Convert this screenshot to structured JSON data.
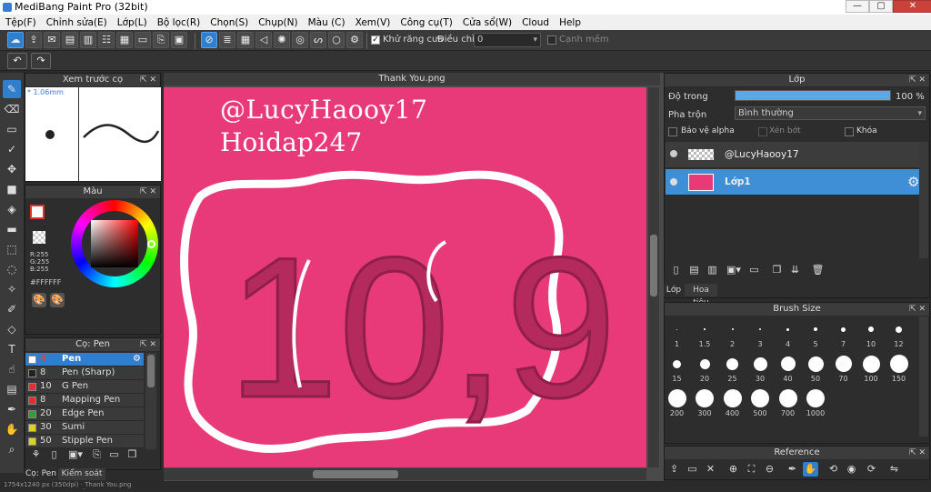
{
  "window": {
    "title": "MediBang Paint Pro (32bit)",
    "buttons": [
      "—",
      "▢",
      "✕"
    ]
  },
  "menu": [
    "Tệp(F)",
    "Chỉnh sửa(E)",
    "Lớp(L)",
    "Bộ lọc(R)",
    "Chọn(S)",
    "Chụp(N)",
    "Màu (C)",
    "Xem(V)",
    "Công cụ(T)",
    "Cửa sổ(W)",
    "Cloud",
    "Help"
  ],
  "toolbar": {
    "antialias_label": "Khử răng cưa",
    "antialias_checked": true,
    "adjust_label": "Điều chỉnh",
    "adjust_value": "0",
    "edge_label": "Cạnh mềm"
  },
  "preview_panel": {
    "title": "Xem trước cọ",
    "size_label": "* 1.06mm"
  },
  "color_panel": {
    "title": "Màu",
    "r": "R:255",
    "g": "G:255",
    "b": "B:255",
    "hex": "#FFFFFF"
  },
  "brush_panel": {
    "title": "Cọ: Pen",
    "brushes": [
      {
        "size": "4",
        "name": "Pen",
        "color": "#ffffff",
        "selected": true
      },
      {
        "size": "8",
        "name": "Pen (Sharp)",
        "color": "#222222"
      },
      {
        "size": "10",
        "name": "G Pen",
        "color": "#e03030"
      },
      {
        "size": "8",
        "name": "Mapping Pen",
        "color": "#e03030"
      },
      {
        "size": "20",
        "name": "Edge Pen",
        "color": "#30a030"
      },
      {
        "size": "30",
        "name": "Sumi",
        "color": "#e0d020"
      },
      {
        "size": "50",
        "name": "Stipple Pen",
        "color": "#e0d020"
      }
    ],
    "tabs": [
      "Cọ: Pen",
      "Kiểm soát cọ"
    ]
  },
  "canvas": {
    "tab_title": "Thank You.png",
    "text_line1": "@LucyHaooy17",
    "text_line2": "Hoidap247",
    "drawn_text": "10,9",
    "background": "#e83a78"
  },
  "layer_panel": {
    "title": "Lớp",
    "opacity_label": "Độ trong",
    "opacity_value": "100 %",
    "opacity_fraction": 1.0,
    "blend_label": "Pha trộn",
    "blend_value": "Bình thường",
    "protect_alpha": "Bảo vệ alpha",
    "clipping": "Xén bớt",
    "lock": "Khóa",
    "layers": [
      {
        "name": "@LucyHaooy17",
        "selected": false
      },
      {
        "name": "Lớp1",
        "selected": true
      }
    ],
    "tabs": [
      "Lớp",
      "Hoa tiêu"
    ]
  },
  "brush_size_panel": {
    "title": "Brush Size",
    "sizes": [
      "1",
      "1.5",
      "2",
      "3",
      "4",
      "5",
      "7",
      "10",
      "12",
      "15",
      "20",
      "25",
      "30",
      "40",
      "50",
      "70",
      "100",
      "150",
      "200",
      "300",
      "400",
      "500",
      "700",
      "1000"
    ]
  },
  "reference_panel": {
    "title": "Reference"
  },
  "status": {
    "text": "1754x1240 px (350dpi)  ·  Thank You.png"
  }
}
